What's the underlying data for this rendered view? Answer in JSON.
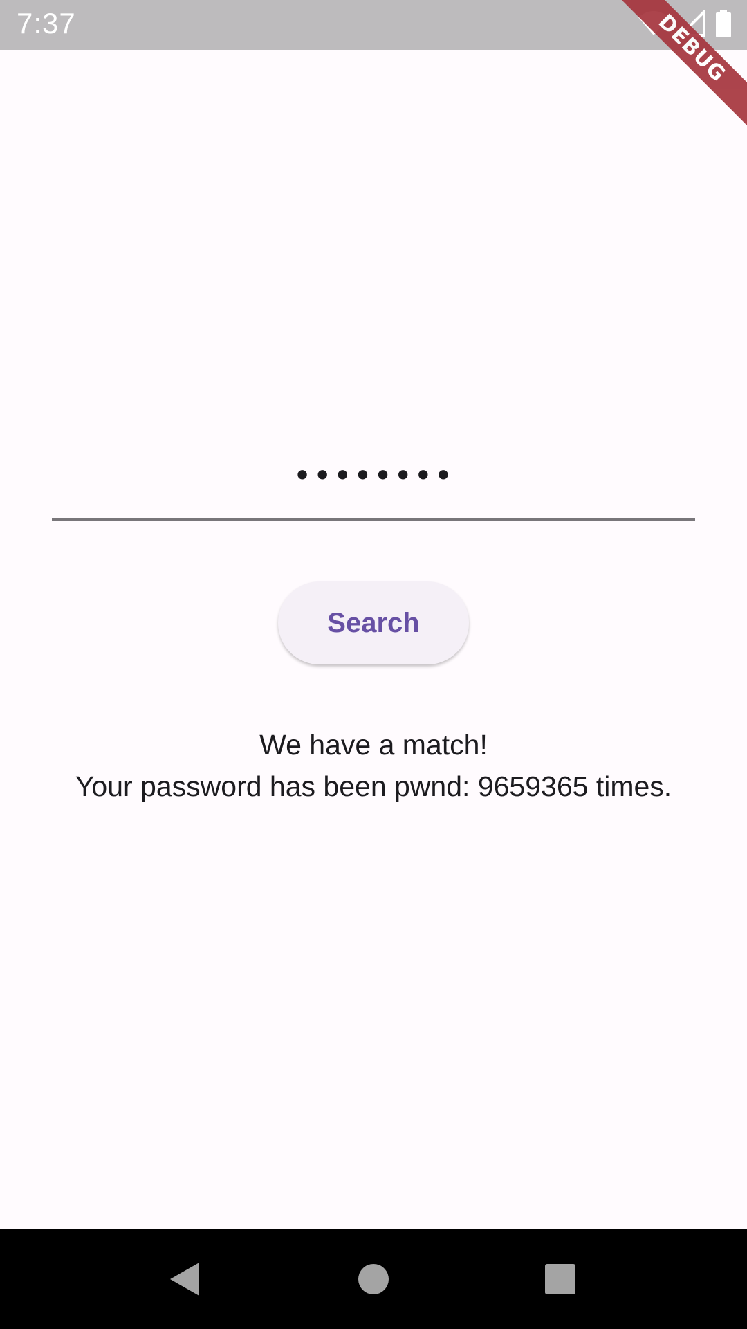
{
  "status_bar": {
    "time": "7:37",
    "icons": [
      "wifi-icon",
      "cell-signal-icon",
      "battery-icon"
    ]
  },
  "debug_banner": {
    "label": "DEBUG",
    "color": "#a6353d"
  },
  "password_field": {
    "value": "••••••••",
    "obscured": true
  },
  "search_button": {
    "label": "Search",
    "color": "#6750a4"
  },
  "result": {
    "line1": "We have a match!",
    "line2": "Your password has been pwnd: 9659365 times."
  },
  "nav_bar": {
    "buttons": [
      "back-icon",
      "home-icon",
      "recents-icon"
    ]
  }
}
